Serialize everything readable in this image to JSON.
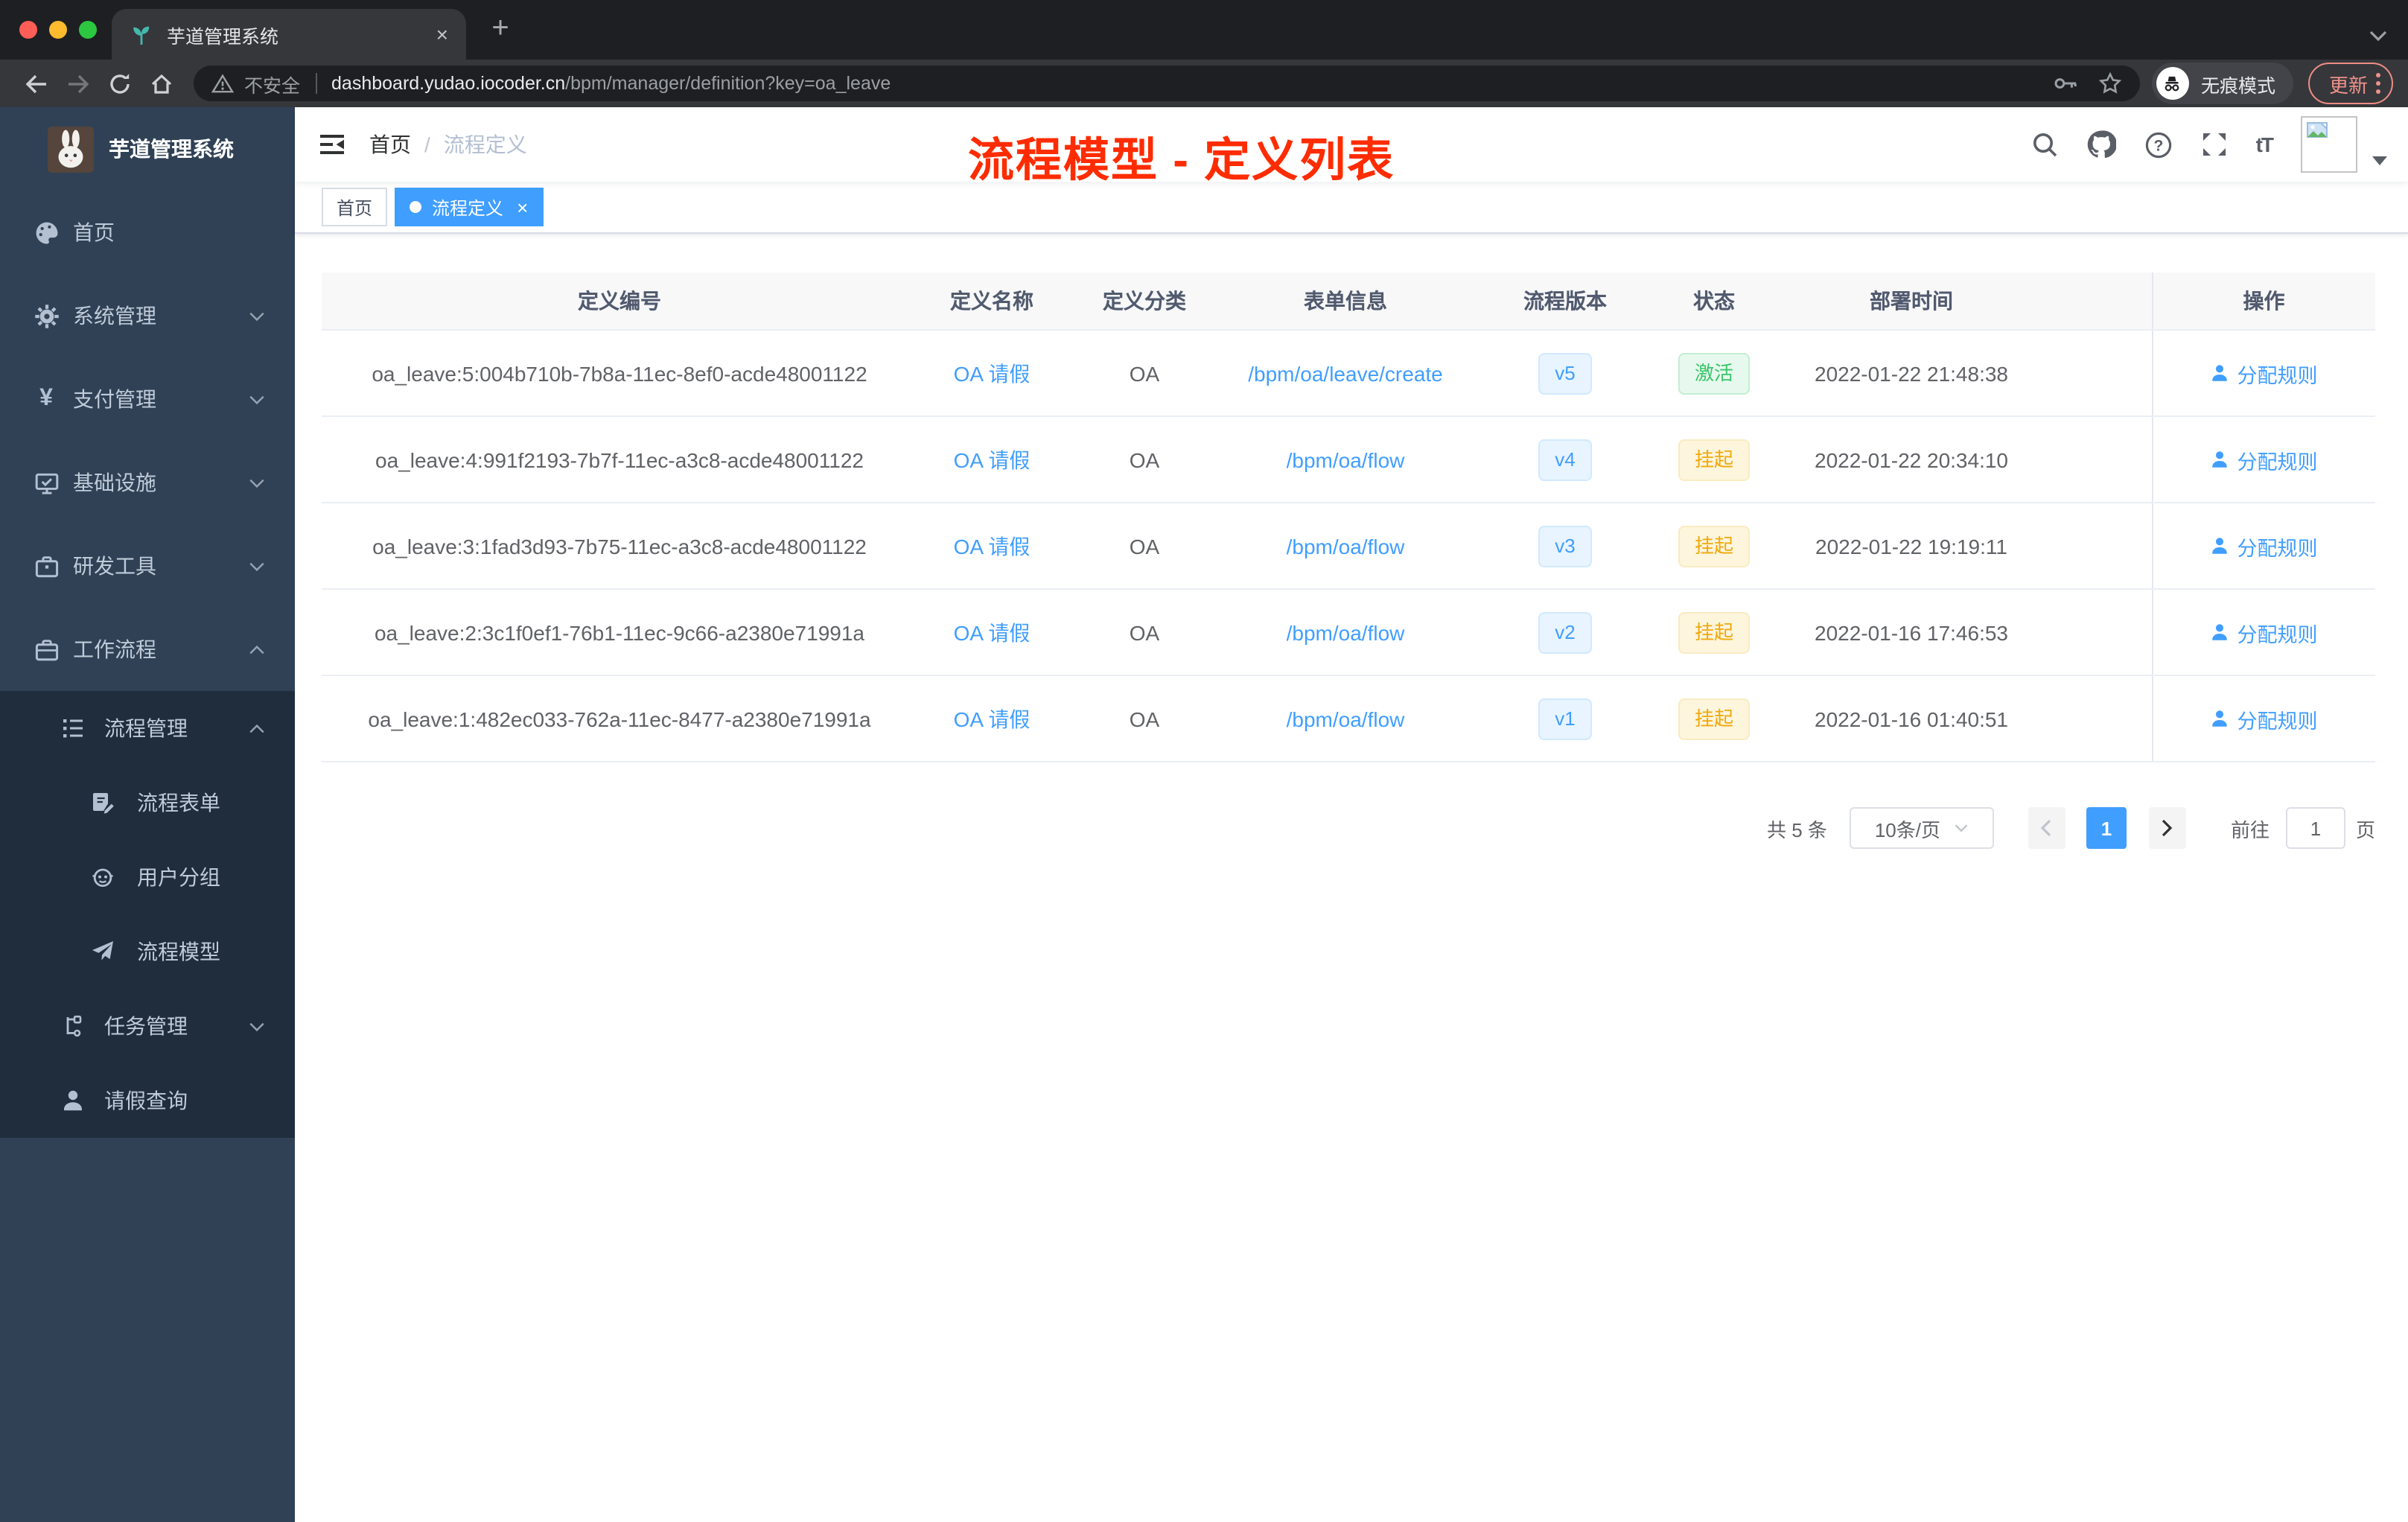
{
  "colors": {
    "accent_blue": "#409eff",
    "success_green": "#3ac569",
    "warning_yellow": "#f0a90c",
    "annotation_red": "#fe2c00",
    "sidebar_bg": "#304156"
  },
  "browser": {
    "tab_title": "芋道管理系统",
    "tab_close": "×",
    "new_tab": "+",
    "security_label": "不安全",
    "url_host": "dashboard.yudao.iocoder.cn",
    "url_path": "/bpm/manager/definition?key=oa_leave",
    "incognito_label": "无痕模式",
    "update_label": "更新"
  },
  "sidebar": {
    "app_title": "芋道管理系统",
    "items": [
      {
        "label": "首页"
      },
      {
        "label": "系统管理"
      },
      {
        "label": "支付管理"
      },
      {
        "label": "基础设施"
      },
      {
        "label": "研发工具"
      },
      {
        "label": "工作流程"
      },
      {
        "label": "流程管理"
      },
      {
        "label": "流程表单"
      },
      {
        "label": "用户分组"
      },
      {
        "label": "流程模型"
      },
      {
        "label": "任务管理"
      },
      {
        "label": "请假查询"
      }
    ]
  },
  "header": {
    "breadcrumb_home": "首页",
    "breadcrumb_sep": "/",
    "breadcrumb_current": "流程定义",
    "annotation": "流程模型 - 定义列表"
  },
  "tags": {
    "home": "首页",
    "active": "流程定义",
    "close": "×"
  },
  "table": {
    "columns": [
      "定义编号",
      "定义名称",
      "定义分类",
      "表单信息",
      "流程版本",
      "状态",
      "部署时间",
      "操作"
    ],
    "action_label": "分配规则",
    "rows": [
      {
        "id": "oa_leave:5:004b710b-7b8a-11ec-8ef0-acde48001122",
        "name": "OA 请假",
        "category": "OA",
        "form": "/bpm/oa/leave/create",
        "version": "v5",
        "status": "激活",
        "status_type": "success",
        "deploy_time": "2022-01-22 21:48:38"
      },
      {
        "id": "oa_leave:4:991f2193-7b7f-11ec-a3c8-acde48001122",
        "name": "OA 请假",
        "category": "OA",
        "form": "/bpm/oa/flow",
        "version": "v4",
        "status": "挂起",
        "status_type": "warning",
        "deploy_time": "2022-01-22 20:34:10"
      },
      {
        "id": "oa_leave:3:1fad3d93-7b75-11ec-a3c8-acde48001122",
        "name": "OA 请假",
        "category": "OA",
        "form": "/bpm/oa/flow",
        "version": "v3",
        "status": "挂起",
        "status_type": "warning",
        "deploy_time": "2022-01-22 19:19:11"
      },
      {
        "id": "oa_leave:2:3c1f0ef1-76b1-11ec-9c66-a2380e71991a",
        "name": "OA 请假",
        "category": "OA",
        "form": "/bpm/oa/flow",
        "version": "v2",
        "status": "挂起",
        "status_type": "warning",
        "deploy_time": "2022-01-16 17:46:53"
      },
      {
        "id": "oa_leave:1:482ec033-762a-11ec-8477-a2380e71991a",
        "name": "OA 请假",
        "category": "OA",
        "form": "/bpm/oa/flow",
        "version": "v1",
        "status": "挂起",
        "status_type": "warning",
        "deploy_time": "2022-01-16 01:40:51"
      }
    ]
  },
  "pagination": {
    "total": "共 5 条",
    "page_size": "10条/页",
    "page": "1",
    "goto": "前往",
    "unit": "页",
    "goto_value": "1"
  }
}
